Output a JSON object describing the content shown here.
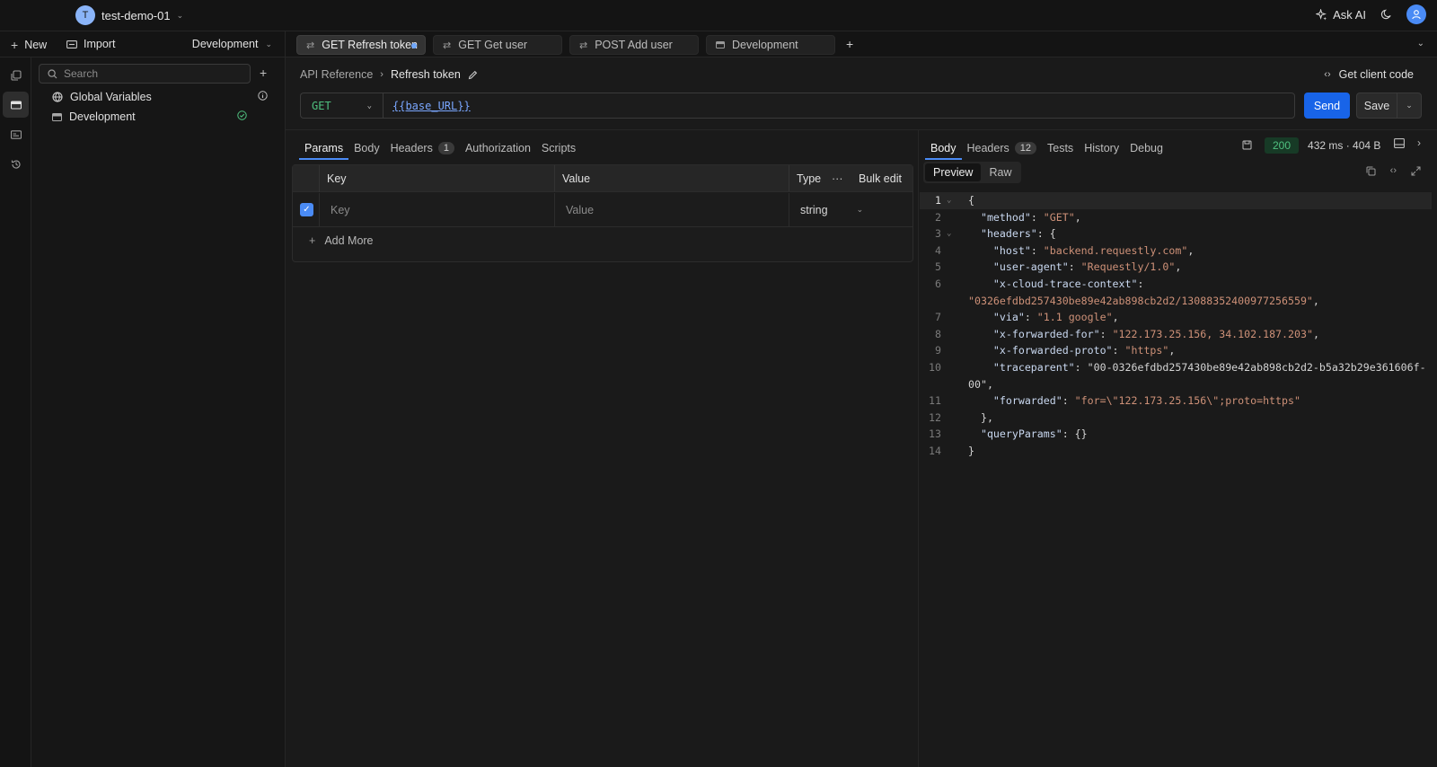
{
  "workspace": {
    "initial": "T",
    "name": "test-demo-01"
  },
  "top_actions": {
    "ask_ai": "Ask AI"
  },
  "sidebar_header": {
    "new_label": "New",
    "import_label": "Import",
    "environment": "Development"
  },
  "sidebar": {
    "search_placeholder": "Search",
    "items": [
      {
        "label": "Global Variables"
      },
      {
        "label": "Development"
      }
    ]
  },
  "tabs": [
    {
      "label": "GET Refresh token",
      "active": true,
      "unsaved": true
    },
    {
      "label": "GET Get user",
      "active": false
    },
    {
      "label": "POST Add user",
      "active": false
    },
    {
      "label": "Development",
      "active": false
    }
  ],
  "breadcrumb": {
    "parent": "API Reference",
    "current": "Refresh token"
  },
  "client_code_label": "Get client code",
  "request": {
    "method": "GET",
    "url": "{{base_URL}}",
    "send_label": "Send",
    "save_label": "Save"
  },
  "request_tabs": [
    {
      "label": "Params"
    },
    {
      "label": "Body"
    },
    {
      "label": "Headers",
      "count": "1"
    },
    {
      "label": "Authorization"
    },
    {
      "label": "Scripts"
    }
  ],
  "params_table": {
    "headers": {
      "key": "Key",
      "value": "Value",
      "type": "Type",
      "bulk_edit": "Bulk edit"
    },
    "row": {
      "key_placeholder": "Key",
      "value_placeholder": "Value",
      "type": "string"
    },
    "add_more": "Add More"
  },
  "response_tabs": [
    {
      "label": "Body"
    },
    {
      "label": "Headers",
      "count": "12"
    },
    {
      "label": "Tests"
    },
    {
      "label": "History"
    },
    {
      "label": "Debug"
    }
  ],
  "response": {
    "status": "200",
    "meta": "432 ms · 404 B",
    "view_modes": [
      "Preview",
      "Raw"
    ]
  },
  "response_body": [
    {
      "n": "1",
      "t": "{"
    },
    {
      "n": "2",
      "t": "  \"method\": \"GET\","
    },
    {
      "n": "3",
      "t": "  \"headers\": {"
    },
    {
      "n": "4",
      "t": "    \"host\": \"backend.requestly.com\","
    },
    {
      "n": "5",
      "t": "    \"user-agent\": \"Requestly/1.0\","
    },
    {
      "n": "6",
      "t": "    \"x-cloud-trace-context\":"
    },
    {
      "n": "",
      "t": "\"0326efdbd257430be89e42ab898cb2d2/13088352400977256559\","
    },
    {
      "n": "7",
      "t": "    \"via\": \"1.1 google\","
    },
    {
      "n": "8",
      "t": "    \"x-forwarded-for\": \"122.173.25.156, 34.102.187.203\","
    },
    {
      "n": "9",
      "t": "    \"x-forwarded-proto\": \"https\","
    },
    {
      "n": "10",
      "t": "    \"traceparent\": \"00-0326efdbd257430be89e42ab898cb2d2-b5a32b29e361606f-"
    },
    {
      "n": "",
      "t": "00\","
    },
    {
      "n": "11",
      "t": "    \"forwarded\": \"for=\\\"122.173.25.156\\\";proto=https\""
    },
    {
      "n": "12",
      "t": "  },"
    },
    {
      "n": "13",
      "t": "  \"queryParams\": {}"
    },
    {
      "n": "14",
      "t": "}"
    }
  ]
}
